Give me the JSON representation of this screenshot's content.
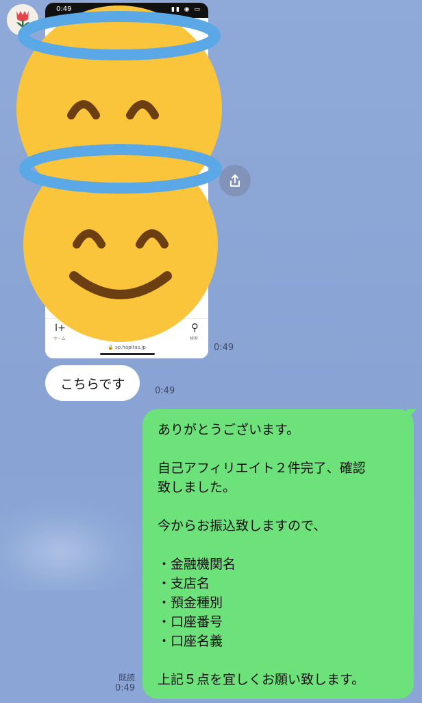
{
  "image_message": {
    "status_time": "0:49",
    "tab_home_label": "ホーム",
    "tab_search_label": "検索",
    "url": "sp.hapitas.jp",
    "time": "0:49"
  },
  "incoming_text": {
    "text": "こちらです",
    "time": "0:49"
  },
  "outgoing": {
    "lines": [
      "ありがとうございます。",
      "",
      "自己アフィリエイト２件完了、確認",
      "致しました。",
      "",
      "今からお振込致しますので、",
      "",
      "・金融機関名",
      "・支店名",
      "・預金種別",
      "・口座番号",
      "・口座名義",
      "",
      "上記５点を宜しくお願い致します。"
    ],
    "read_label": "既読",
    "time": "0:49"
  },
  "colors": {
    "background": "#8aa5d6",
    "outgoing_bubble": "#6ee27a",
    "incoming_bubble": "#ffffff",
    "emoji_face": "#fbc53b",
    "halo": "#5aa8e6"
  },
  "icons": [
    "tulip-avatar-icon",
    "smiling-face-with-halo-emoji",
    "share-icon",
    "home-icon",
    "search-icon"
  ]
}
